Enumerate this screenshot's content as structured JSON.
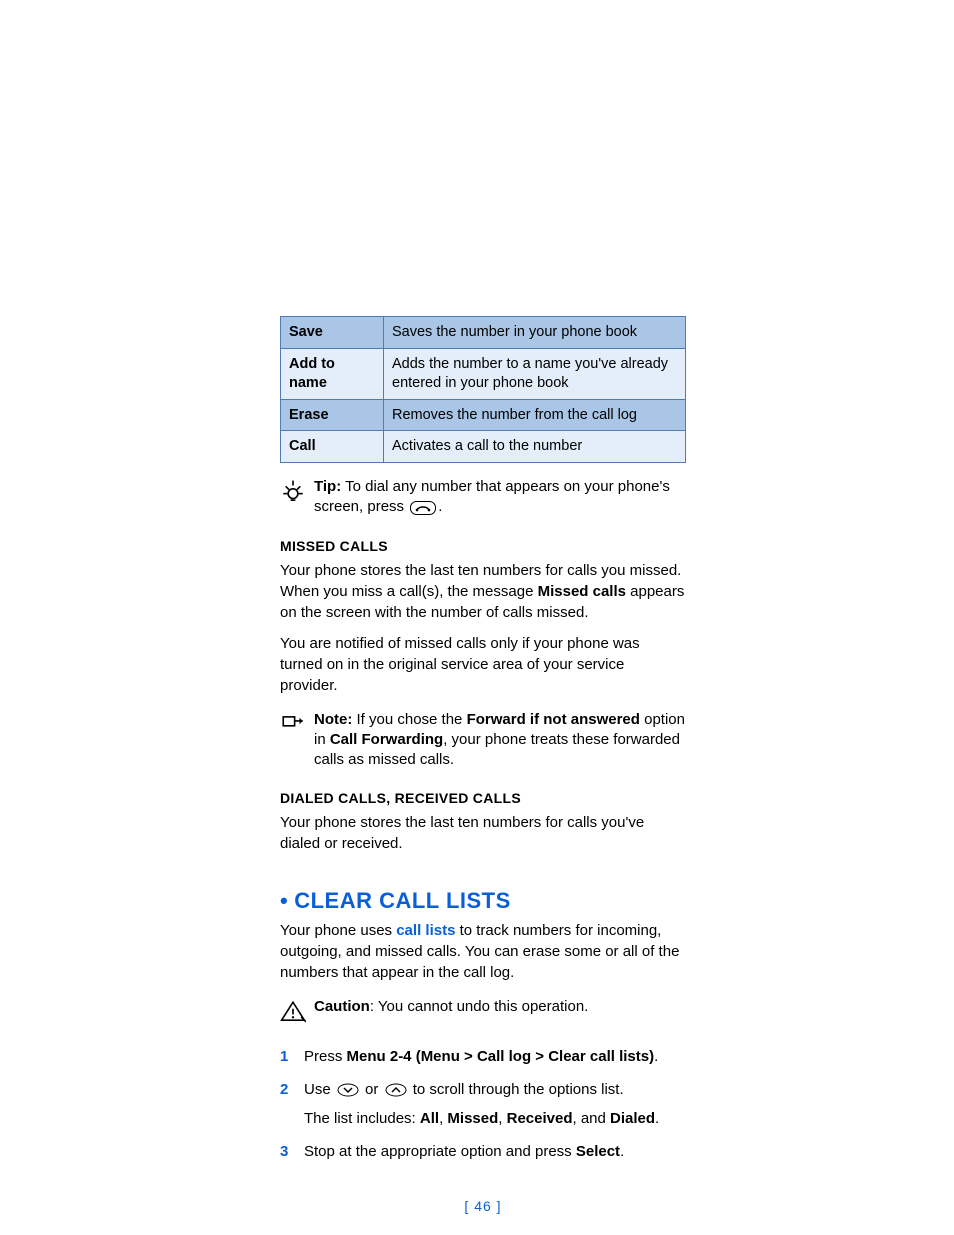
{
  "table": {
    "rows": [
      {
        "label": "Save",
        "desc": "Saves the number in your phone book"
      },
      {
        "label": "Add to name",
        "desc": "Adds the number to a name you've already entered in your phone book"
      },
      {
        "label": "Erase",
        "desc": "Removes the number from the call log"
      },
      {
        "label": "Call",
        "desc": "Activates a call to the number"
      }
    ]
  },
  "tip": {
    "lead": "Tip:",
    "part1": " To dial any number that appears on your phone's screen, press ",
    "part2": "."
  },
  "missed": {
    "heading": "MISSED CALLS",
    "p1a": "Your phone stores the last ten numbers for calls you missed. When you miss a call(s), the message ",
    "p1b": "Missed calls",
    "p1c": " appears on the screen with the number of calls missed.",
    "p2": "You are notified of missed calls only if your phone was turned on in the original service area of your service provider."
  },
  "note": {
    "lead": "Note: ",
    "a": " If you chose the ",
    "b": "Forward if not answered",
    "c": " option in ",
    "d": "Call Forwarding",
    "e": ", your phone treats these forwarded calls as missed calls."
  },
  "dialed": {
    "heading": "DIALED CALLS, RECEIVED CALLS",
    "p": "Your phone stores the last ten numbers for calls you've dialed or received."
  },
  "section": {
    "title": "CLEAR CALL LISTS",
    "intro_a": "Your phone uses ",
    "intro_link": "call lists",
    "intro_b": " to track numbers for incoming, outgoing, and missed calls. You can erase some or all of the numbers that appear in the call log."
  },
  "caution": {
    "lead": "Caution",
    "rest": ": You cannot undo this operation."
  },
  "steps": {
    "s1a": "Press ",
    "s1b": "Menu 2-4 (Menu > Call log > Clear call lists)",
    "s1c": ".",
    "s2a": "Use ",
    "s2b": " or ",
    "s2c": " to scroll through the options list.",
    "s2sub_a": "The list includes: ",
    "s2sub_b": "All",
    "s2sub_c": ", ",
    "s2sub_d": "Missed",
    "s2sub_e": ", ",
    "s2sub_f": "Received",
    "s2sub_g": ", and ",
    "s2sub_h": "Dialed",
    "s2sub_i": ".",
    "s3a": "Stop at the appropriate option and press ",
    "s3b": "Select",
    "s3c": "."
  },
  "pagenum": "[ 46 ]"
}
